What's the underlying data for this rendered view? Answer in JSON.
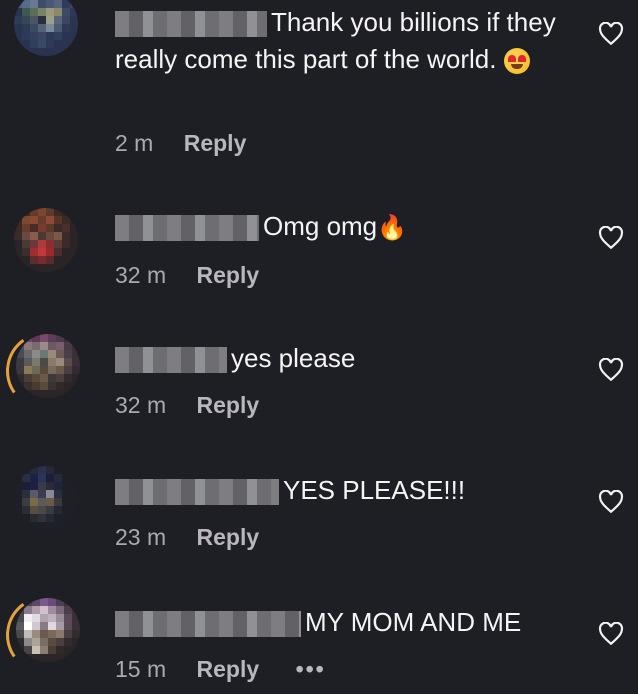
{
  "comments": [
    {
      "text": "Thank you billions if they really come this part of the world.",
      "time": "2 m",
      "reply": "Reply",
      "has_emoji": "heart-eyes-emoji"
    },
    {
      "text": "Omg omg",
      "time": "32 m",
      "reply": "Reply",
      "has_emoji": "fire-emoji"
    },
    {
      "text": "yes please",
      "time": "32 m",
      "reply": "Reply"
    },
    {
      "text": "YES PLEASE!!!",
      "time": "23 m",
      "reply": "Reply"
    },
    {
      "text": "MY MOM AND ME",
      "time": "15 m",
      "reply": "Reply",
      "more": "•••"
    }
  ],
  "icons": {
    "like": "heart-outline-icon",
    "story_ring_color": "#e5a23a"
  }
}
